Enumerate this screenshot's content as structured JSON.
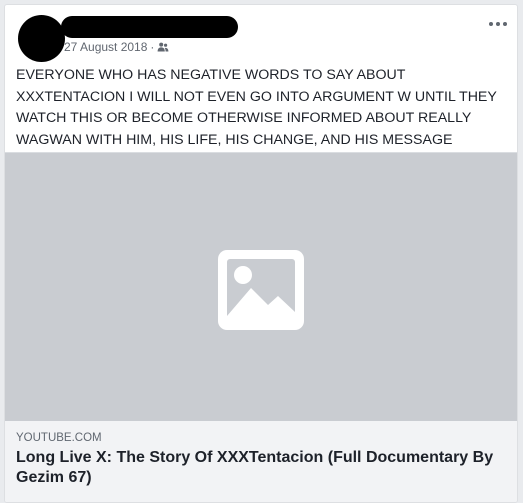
{
  "post": {
    "date": "27 August 2018",
    "separator": "·",
    "audience_icon": "friends-icon",
    "more_icon": "more-options-icon",
    "text": "EVERYONE WHO HAS NEGATIVE WORDS TO SAY ABOUT XXXTENTACION I WILL NOT EVEN GO INTO ARGUMENT W UNTIL THEY WATCH THIS OR BECOME OTHERWISE INFORMED ABOUT REALLY WAGWAN WITH HIM, HIS LIFE, HIS CHANGE, AND HIS MESSAGE"
  },
  "media": {
    "placeholder_icon": "image-placeholder-icon",
    "background_color": "#c9ccd1"
  },
  "link": {
    "domain": "YOUTUBE.COM",
    "title": "Long Live X: The Story Of XXXTentacion (Full Documentary By Gezim 67)"
  },
  "colors": {
    "page_background": "#e9ebee",
    "card_background": "#ffffff",
    "text": "#1d2129",
    "secondary_text": "#616770",
    "link_preview_background": "#f2f3f5"
  }
}
